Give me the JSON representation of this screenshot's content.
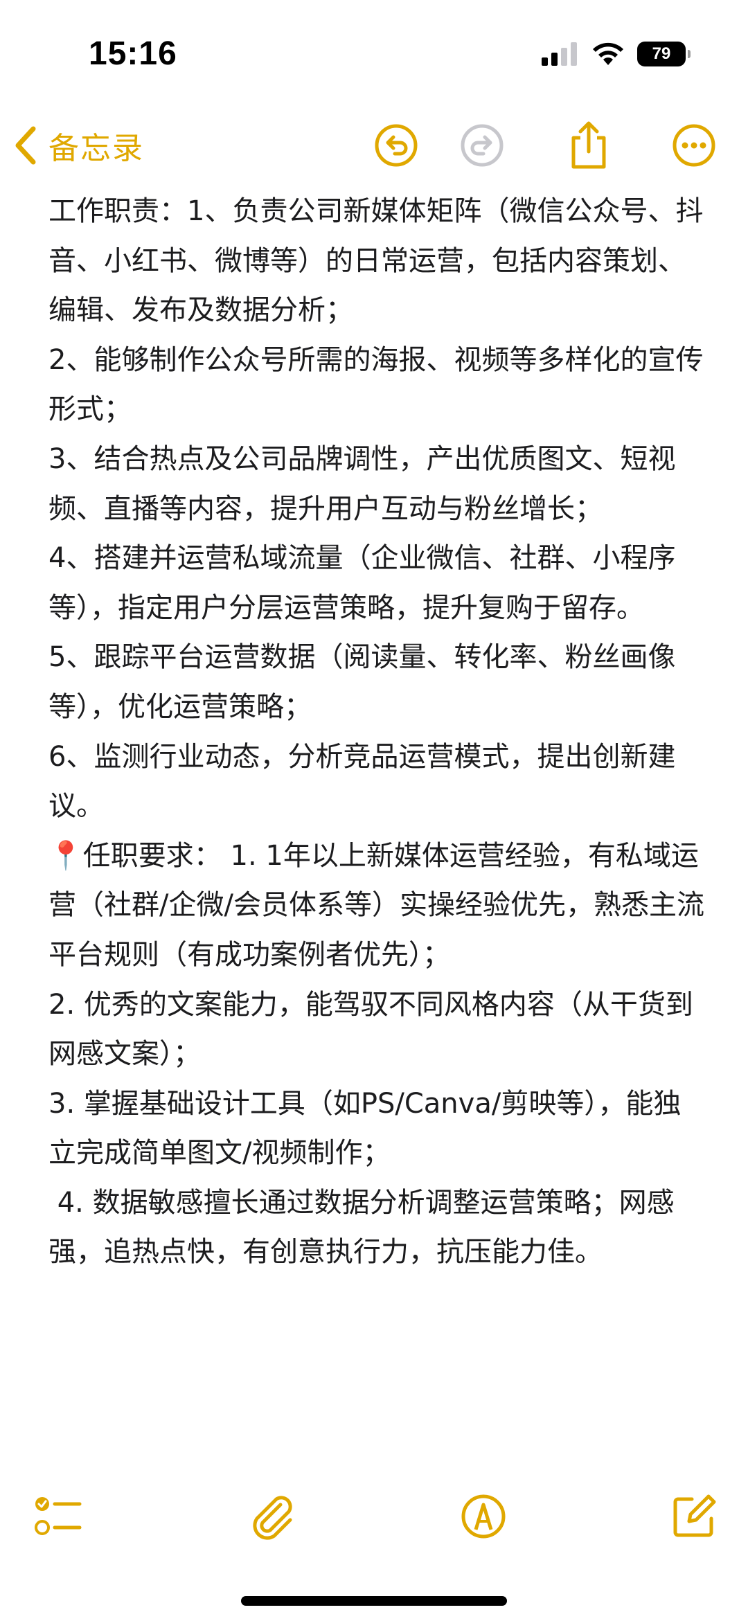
{
  "status": {
    "time": "15:16",
    "battery": "79"
  },
  "nav": {
    "back_label": "备忘录"
  },
  "note": {
    "lines": [
      "工作职责：1、负责公司新媒体矩阵（微信公众号、抖音、小红书、微博等）的日常运营，包括内容策划、编辑、发布及数据分析；",
      "2、能够制作公众号所需的海报、视频等多样化的宣传形式；",
      "3、结合热点及公司品牌调性，产出优质图文、短视频、直播等内容，提升用户互动与粉丝增长；",
      "4、搭建并运营私域流量（企业微信、社群、小程序等），指定用户分层运营策略，提升复购于留存。",
      "5、跟踪平台运营数据（阅读量、转化率、粉丝画像等），优化运营策略；",
      "6、监测行业动态，分析竞品运营模式，提出创新建议。",
      "📍任职要求： 1. 1年以上新媒体运营经验，有私域运营（社群/企微/会员体系等）实操经验优先，熟悉主流平台规则（有成功案例者优先）；",
      "2. 优秀的文案能力，能驾驭不同风格内容（从干货到网感文案）；",
      "3. 掌握基础设计工具（如PS/Canva/剪映等），能独立完成简单图文/视频制作；",
      " 4. 数据敏感擅长通过数据分析调整运营策略；网感强，追热点快，有创意执行力，抗压能力佳。"
    ]
  },
  "colors": {
    "accent": "#E0A800",
    "text": "#1c1c1e",
    "disabled": "#c7c7cc"
  },
  "icons": {
    "undo": "undo-icon",
    "redo": "redo-icon",
    "share": "share-icon",
    "more": "more-icon",
    "checklist": "checklist-icon",
    "attachment": "paperclip-icon",
    "markup": "markup-icon",
    "compose": "compose-icon"
  }
}
